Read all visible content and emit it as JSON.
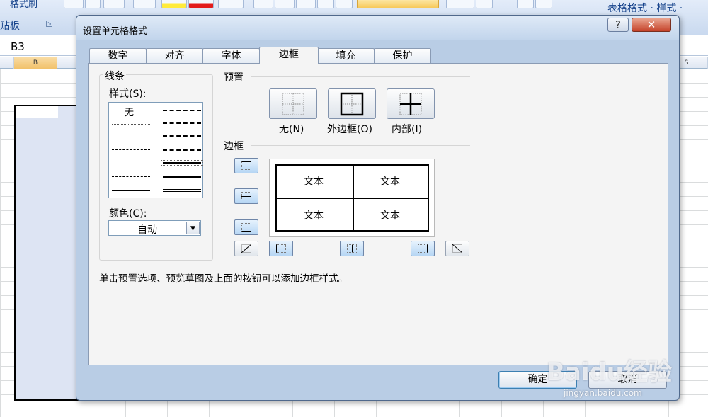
{
  "excel": {
    "clipboard_label": "贴板",
    "format_painter": "格式刷",
    "table_format": "表格格式 · 样式 ·",
    "name_box": "B3",
    "col_b": "B",
    "col_s": "S"
  },
  "dialog": {
    "title": "设置单元格格式",
    "help": "?",
    "close": "✕",
    "tabs": [
      "数字",
      "对齐",
      "字体",
      "边框",
      "填充",
      "保护"
    ],
    "active_tab": "边框",
    "line_group": "线条",
    "style_label": "样式(S):",
    "style_none": "无",
    "color_label": "颜色(C):",
    "color_value": "自动",
    "presets_group": "预置",
    "presets": [
      "无(N)",
      "外边框(O)",
      "内部(I)"
    ],
    "border_group": "边框",
    "preview_text": [
      "文本",
      "文本",
      "文本",
      "文本"
    ],
    "hint": "单击预置选项、预览草图及上面的按钮可以添加边框样式。",
    "ok": "确定",
    "cancel": "取消"
  },
  "watermark": {
    "text": "Baidu经验",
    "url": "jingyan.baidu.com"
  }
}
